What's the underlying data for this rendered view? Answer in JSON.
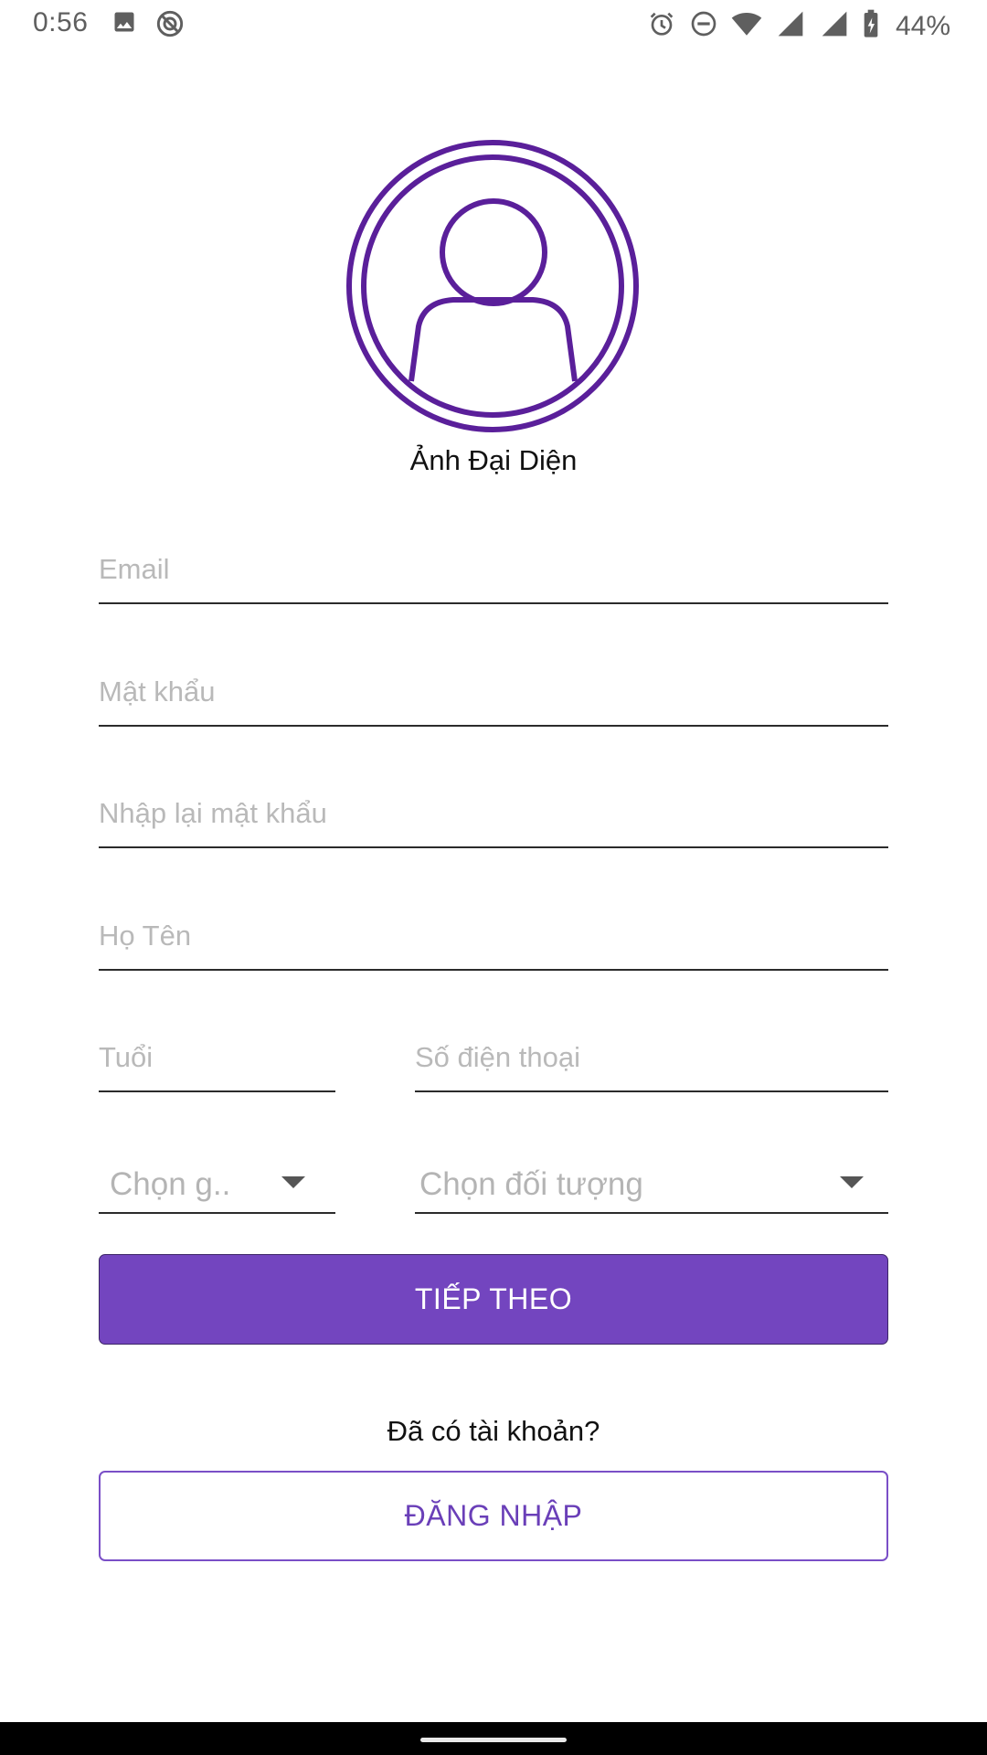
{
  "status_bar": {
    "time": "0:56",
    "battery_percent": "44%",
    "left_icons": [
      "image-icon",
      "sync-disabled-icon"
    ],
    "right_icons": [
      "alarm-icon",
      "do-not-disturb-icon",
      "wifi-icon",
      "signal-icon",
      "signal-icon",
      "battery-charging-icon"
    ]
  },
  "avatar": {
    "caption": "Ảnh Đại Diện",
    "icon": "user-avatar-icon",
    "color": "#5a1f9a"
  },
  "form": {
    "email_placeholder": "Email",
    "password_placeholder": "Mật khẩu",
    "confirm_password_placeholder": "Nhập lại mật khẩu",
    "full_name_placeholder": "Họ Tên",
    "age_placeholder": "Tuổi",
    "phone_placeholder": "Số điện thoại",
    "gender_select": "Chọn g..",
    "target_select": "Chọn đối tượng"
  },
  "actions": {
    "next_label": "TIẾP THEO",
    "have_account_text": "Đã có tài khoản?",
    "login_label": "ĐĂNG NHẬP"
  },
  "colors": {
    "accent": "#7345bf",
    "accent_text": "#6a3fb8"
  }
}
